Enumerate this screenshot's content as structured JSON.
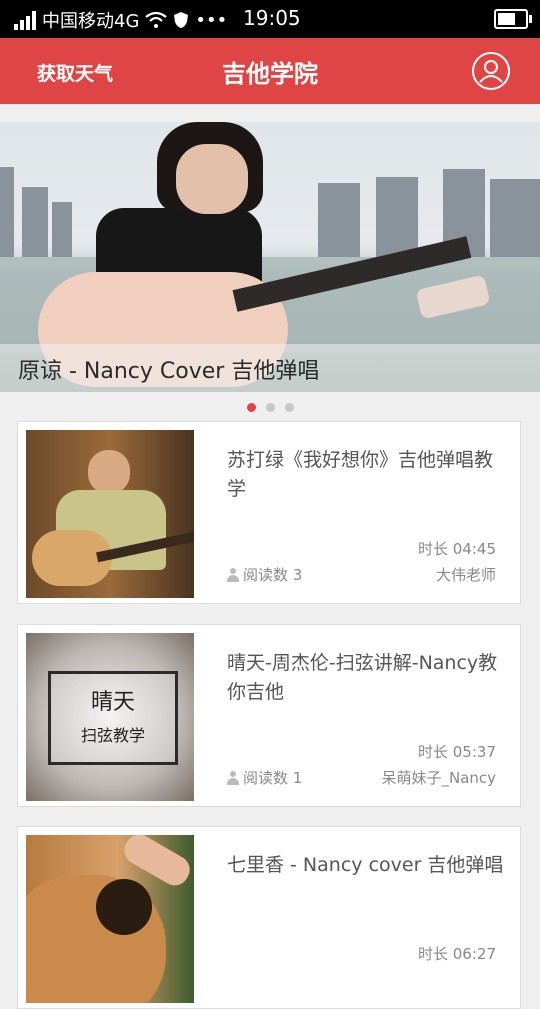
{
  "status_bar": {
    "carrier": "中国移动4G",
    "time": "19:05",
    "battery_level": 0.55
  },
  "header": {
    "weather_button": "获取天气",
    "title": "吉他学院",
    "user_icon": "user-circle-icon"
  },
  "banner": {
    "caption": "原谅 - Nancy Cover 吉他弹唱",
    "page_count": 3,
    "active_page": 1
  },
  "articles": [
    {
      "title": "苏打绿《我好想你》吉他弹唱教学",
      "duration": "时长 04:45",
      "reads": "阅读数 3",
      "author": "大伟老师"
    },
    {
      "title": "晴天-周杰伦-扫弦讲解-Nancy教你吉他",
      "duration": "时长 05:37",
      "reads": "阅读数 1",
      "author": "呆萌妹子_Nancy",
      "thumb_text_1": "晴天",
      "thumb_text_2": "扫弦教学"
    },
    {
      "title": "七里香 - Nancy cover 吉他弹唱",
      "duration": "时长 06:27"
    }
  ],
  "colors": {
    "brand": "#e04545",
    "background": "#efefef"
  }
}
